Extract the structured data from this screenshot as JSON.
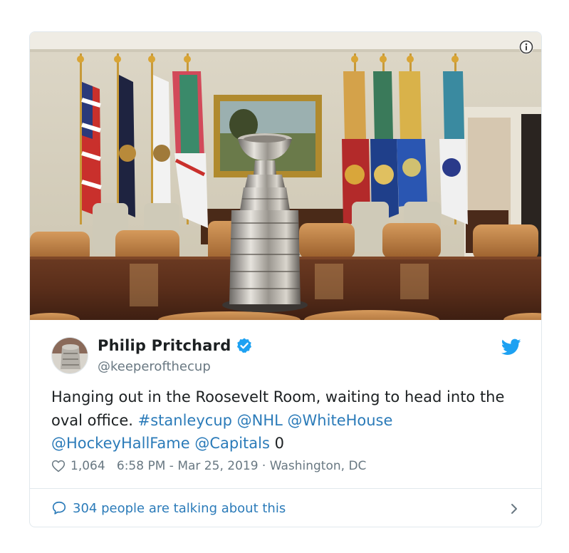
{
  "tweet": {
    "author_name": "Philip Pritchard",
    "author_handle": "@keeperofthecup",
    "text_plain_1": "Hanging out in the Roosevelt Room, waiting to head into the oval office.",
    "hashtag": "#stanleycup",
    "mention_nhl": "@NHL",
    "mention_whitehouse": "@WhiteHouse",
    "mention_hhof": "@HockeyHallFame",
    "mention_capitals": "@Capitals",
    "text_trailing": " 0",
    "likes": "1,064",
    "timestamp": "6:58 PM - Mar 25, 2019",
    "separator": " · ",
    "location": "Washington, DC",
    "talking_label": "304 people are talking about this"
  },
  "colors": {
    "link": "#2b7bb9",
    "meta": "#697882",
    "text": "#1c2022",
    "verified": "#1da1f2",
    "twitter_bird": "#1da1f2",
    "border": "#e1e8ed"
  },
  "icons": {
    "info": "info-icon",
    "verified": "verified-badge-icon",
    "bird": "twitter-bird-icon",
    "heart": "heart-icon",
    "comment": "speech-bubble-icon",
    "chevron": "chevron-right-icon"
  }
}
